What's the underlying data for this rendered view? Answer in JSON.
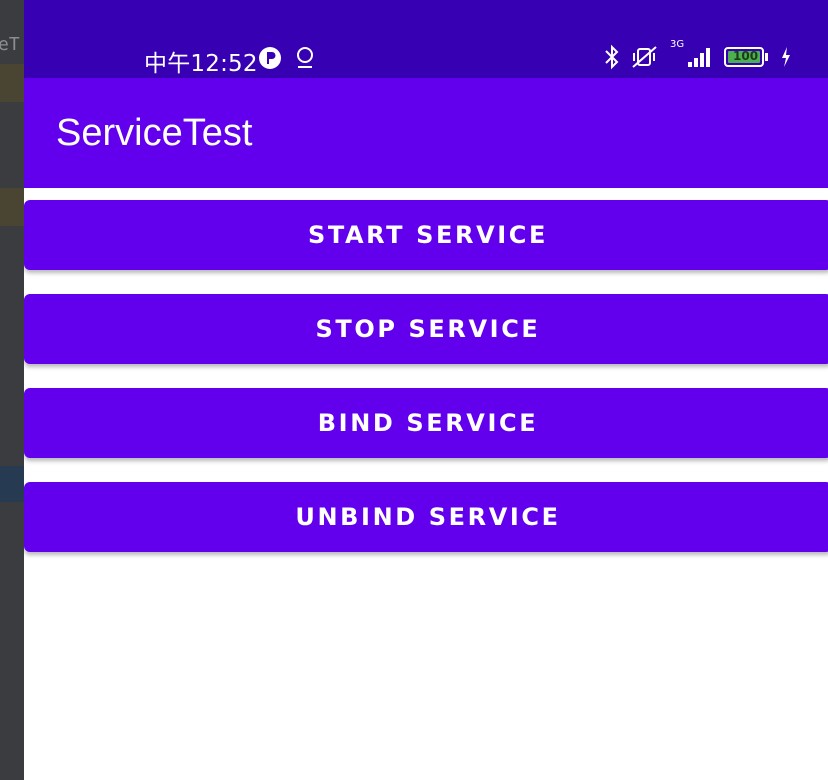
{
  "status_bar": {
    "time": "中午12:52",
    "battery": "100",
    "network": "3G",
    "background_color": "#3700b3",
    "left_icons": [
      "app-notification-icon",
      "location-icon"
    ],
    "right_icons": [
      "bluetooth-icon",
      "vibrate-off-icon",
      "signal-icon",
      "battery-icon",
      "charging-icon"
    ]
  },
  "app_bar": {
    "title": "ServiceTest",
    "background_color": "#6200ee"
  },
  "buttons": [
    {
      "label": "START SERVICE"
    },
    {
      "label": "STOP SERVICE"
    },
    {
      "label": "BIND SERVICE"
    },
    {
      "label": "UNBIND SERVICE"
    }
  ],
  "ide_strip": {
    "partial_text": "eT"
  }
}
